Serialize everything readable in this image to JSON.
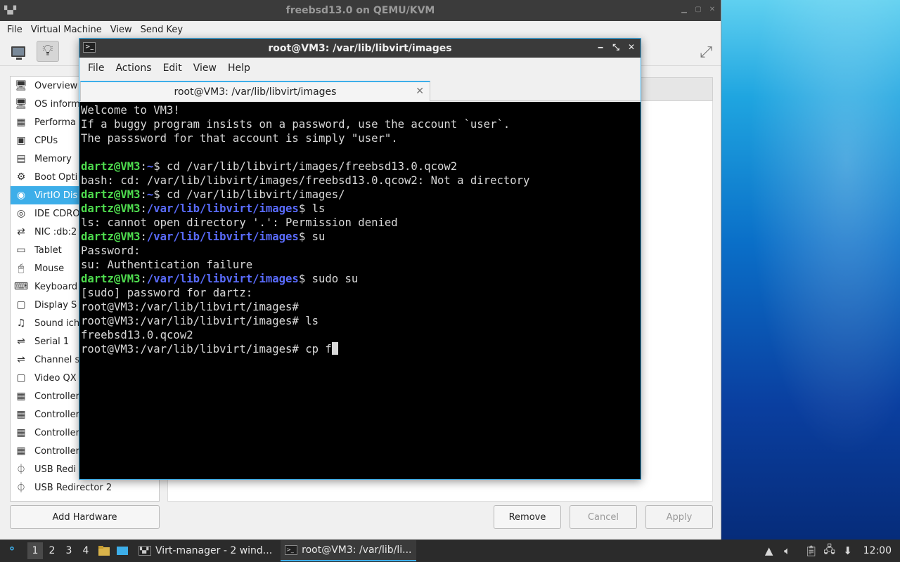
{
  "vm_window": {
    "title": "freebsd13.0 on QEMU/KVM",
    "menu": [
      "File",
      "Virtual Machine",
      "View",
      "Send Key"
    ],
    "hardware_list": [
      {
        "label": "Overview",
        "icon": "overview-icon"
      },
      {
        "label": "OS inform",
        "icon": "os-info-icon"
      },
      {
        "label": "Performa",
        "icon": "performance-icon"
      },
      {
        "label": "CPUs",
        "icon": "cpu-icon"
      },
      {
        "label": "Memory",
        "icon": "memory-icon"
      },
      {
        "label": "Boot Opti",
        "icon": "boot-options-icon"
      },
      {
        "label": "VirtIO Dis",
        "icon": "disk-icon",
        "selected": true
      },
      {
        "label": "IDE CDRO",
        "icon": "cdrom-icon"
      },
      {
        "label": "NIC :db:2",
        "icon": "nic-icon"
      },
      {
        "label": "Tablet",
        "icon": "tablet-icon"
      },
      {
        "label": "Mouse",
        "icon": "mouse-icon"
      },
      {
        "label": "Keyboard",
        "icon": "keyboard-icon"
      },
      {
        "label": "Display S",
        "icon": "display-icon"
      },
      {
        "label": "Sound ich",
        "icon": "sound-icon"
      },
      {
        "label": "Serial 1",
        "icon": "serial-icon"
      },
      {
        "label": "Channel s",
        "icon": "channel-icon"
      },
      {
        "label": "Video QX",
        "icon": "video-icon"
      },
      {
        "label": "Controller",
        "icon": "controller-icon"
      },
      {
        "label": "Controller",
        "icon": "controller-icon"
      },
      {
        "label": "Controller",
        "icon": "controller-icon"
      },
      {
        "label": "Controller",
        "icon": "controller-icon"
      },
      {
        "label": "USB Redi",
        "icon": "usb-redirector-icon"
      },
      {
        "label": "USB Redirector 2",
        "icon": "usb-redirector-icon"
      }
    ],
    "buttons": {
      "add_hardware": "Add Hardware",
      "remove": "Remove",
      "cancel": "Cancel",
      "apply": "Apply"
    }
  },
  "terminal": {
    "title": "root@VM3: /var/lib/libvirt/images",
    "menu": [
      "File",
      "Actions",
      "Edit",
      "View",
      "Help"
    ],
    "tab_label": "root@VM3: /var/lib/libvirt/images",
    "lines": [
      {
        "text": "Welcome to VM3!"
      },
      {
        "text": "If a buggy program insists on a password, use the account `user`."
      },
      {
        "text": "The passsword for that account is simply \"user\"."
      },
      {
        "text": ""
      },
      {
        "user": "dartz@VM3",
        "path": "~",
        "cmd": " cd /var/lib/libvirt/images/freebsd13.0.qcow2"
      },
      {
        "text": "bash: cd: /var/lib/libvirt/images/freebsd13.0.qcow2: Not a directory"
      },
      {
        "user": "dartz@VM3",
        "path": "~",
        "cmd": " cd /var/lib/libvirt/images/"
      },
      {
        "user": "dartz@VM3",
        "path": "/var/lib/libvirt/images",
        "cmd": " ls"
      },
      {
        "text": "ls: cannot open directory '.': Permission denied"
      },
      {
        "user": "dartz@VM3",
        "path": "/var/lib/libvirt/images",
        "cmd": " su"
      },
      {
        "text": "Password:"
      },
      {
        "text": "su: Authentication failure"
      },
      {
        "user": "dartz@VM3",
        "path": "/var/lib/libvirt/images",
        "cmd": " sudo su"
      },
      {
        "text": "[sudo] password for dartz:"
      },
      {
        "text": "root@VM3:/var/lib/libvirt/images#"
      },
      {
        "text": "root@VM3:/var/lib/libvirt/images# ls"
      },
      {
        "text": "freebsd13.0.qcow2"
      },
      {
        "text": "root@VM3:/var/lib/libvirt/images# cp f",
        "cursor": true
      }
    ]
  },
  "taskbar": {
    "workspaces": [
      "1",
      "2",
      "3",
      "4"
    ],
    "active_workspace": 0,
    "tasks": [
      {
        "label": "Virt-manager - 2 wind...",
        "icon": "virt-manager-icon",
        "active": false
      },
      {
        "label": "root@VM3: /var/lib/li...",
        "icon": "terminal-icon",
        "active": true
      }
    ],
    "clock": "12:00"
  },
  "colors": {
    "accent": "#3daee9",
    "prompt_user": "#4edc4e",
    "prompt_path": "#5a6cff"
  }
}
